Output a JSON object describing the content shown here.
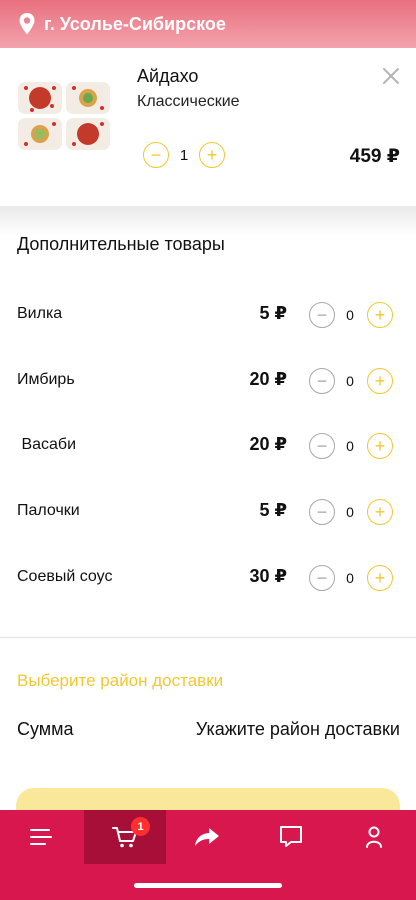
{
  "header": {
    "city": "г. Усолье-Сибирское"
  },
  "cart_item": {
    "name": "Айдахо",
    "subtitle": "Классические",
    "quantity": "1",
    "price": "459 ₽",
    "minus": "−",
    "plus": "+"
  },
  "extras": {
    "title": "Дополнительные товары",
    "items": [
      {
        "label": "Вилка",
        "price": "5 ₽",
        "count": "0"
      },
      {
        "label": "Имбирь",
        "price": "20 ₽",
        "count": "0"
      },
      {
        "label": " Васаби",
        "price": "20 ₽",
        "count": "0"
      },
      {
        "label": "Палочки",
        "price": "5 ₽",
        "count": "0"
      },
      {
        "label": "Соевый соус",
        "price": "30 ₽",
        "count": "0"
      }
    ],
    "minus": "−",
    "plus": "+"
  },
  "delivery": {
    "select_district": "Выберите район доставки",
    "sum_label": "Сумма",
    "sum_value": "Укажите район доставки"
  },
  "tab_bar": {
    "active_tab": "cart",
    "cart_badge": "1",
    "tabs": [
      "menu-icon",
      "cart-icon",
      "share-icon",
      "chat-icon",
      "profile-icon"
    ]
  },
  "colors": {
    "accent_yellow": "#f2c830",
    "tab_bar": "#d9174f",
    "tab_active": "#a80f38",
    "header_gradient_top": "#e8707e",
    "header_gradient_bottom": "#f3a3ad"
  }
}
